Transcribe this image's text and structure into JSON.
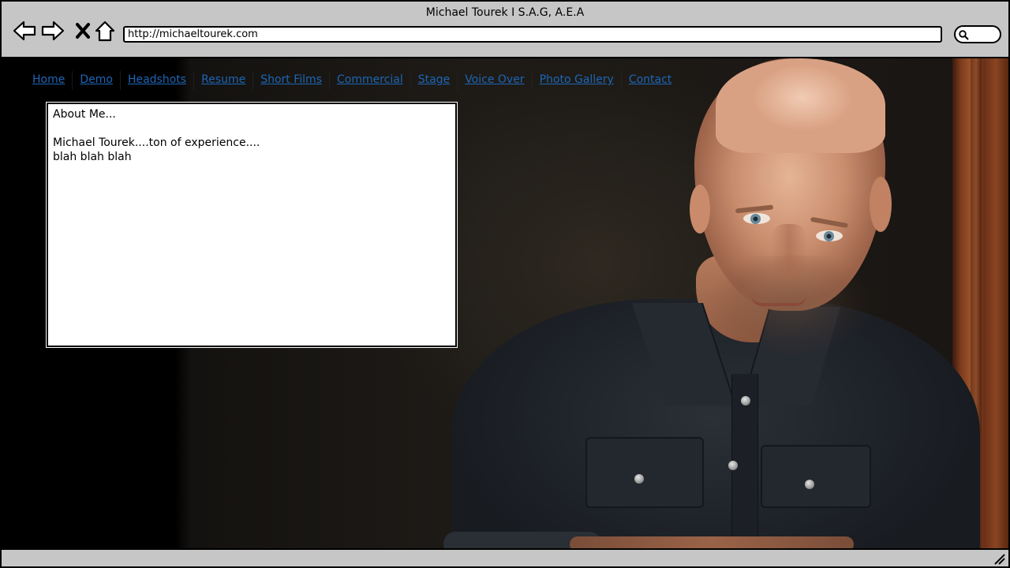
{
  "window": {
    "title": "Michael Tourek I S.A.G, A.E.A"
  },
  "toolbar": {
    "address": "http://michaeltourek.com",
    "icons": {
      "back": "back-arrow-icon",
      "forward": "forward-arrow-icon",
      "stop": "close-icon",
      "home": "home-icon",
      "search": "search-icon"
    }
  },
  "nav": {
    "items": [
      {
        "label": "Home"
      },
      {
        "label": "Demo"
      },
      {
        "label": "Headshots"
      },
      {
        "label": "Resume"
      },
      {
        "label": "Short Films"
      },
      {
        "label": "Commercial"
      },
      {
        "label": "Stage"
      },
      {
        "label": "Voice Over"
      },
      {
        "label": "Photo Gallery"
      },
      {
        "label": "Contact"
      }
    ]
  },
  "about": {
    "heading": "About Me...",
    "line1": "Michael Tourek....ton of experience....",
    "line2": "blah blah blah"
  },
  "colors": {
    "link": "#1d66b5",
    "chrome": "#c6c6c6",
    "page_background": "#000000"
  }
}
